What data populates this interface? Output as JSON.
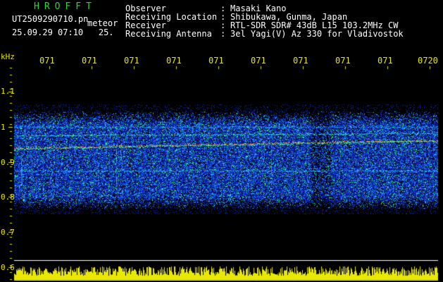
{
  "app_title": "HROFFT",
  "file_name": "UT2509290710.pn",
  "meteor_tag": "meteor",
  "datetime": "25.09.29 07:10",
  "counter": "25.",
  "header": {
    "labels": [
      "Observer",
      "Receiving Location",
      "Receiver",
      "Receiving Antenna"
    ],
    "values": [
      "Masaki Kano",
      "Shibukawa, Gunma, Japan",
      "RTL-SDR SDR# 43dB L15 103.2MHz CW",
      "3el Yagi(V) Az 330 for Vladivostok"
    ]
  },
  "axis": {
    "unit": "kHz",
    "y_ticks": [
      "1.1",
      "1",
      "0.9",
      "0.8",
      "0.7",
      "0.6"
    ],
    "x_ticks": [
      "071",
      "071",
      "071",
      "071",
      "071",
      "071",
      "071",
      "071",
      "071",
      "0720"
    ]
  },
  "colors": {
    "background": "#000000",
    "label": "#ffffff",
    "axis": "#e8e800",
    "title": "#2fd62f",
    "noise_low": "#0a1478",
    "noise_high": "#2a78ff",
    "signal_line": "#ffd23a",
    "histogram": "#e8e800"
  }
}
